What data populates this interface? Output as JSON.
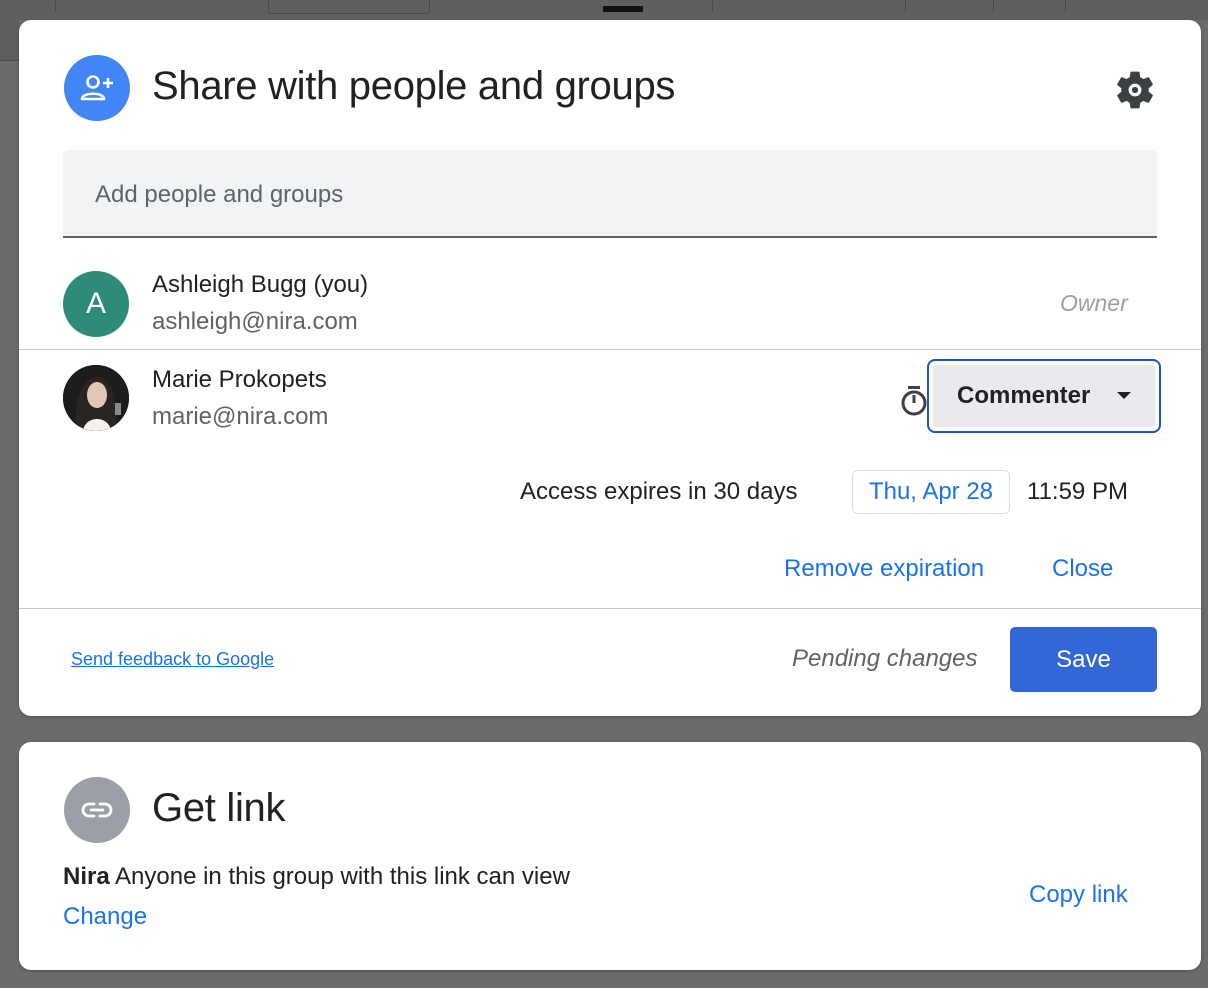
{
  "share": {
    "title": "Share with people and groups",
    "add_placeholder": "Add people and groups",
    "people": [
      {
        "initial": "A",
        "name": "Ashleigh Bugg (you)",
        "email": "ashleigh@nira.com",
        "role": "Owner"
      },
      {
        "name": "Marie Prokopets",
        "email": "marie@nira.com",
        "role": "Commenter"
      }
    ],
    "expiration": {
      "text": "Access expires in 30 days",
      "date": "Thu, Apr 28",
      "time": "11:59 PM",
      "remove_label": "Remove expiration",
      "close_label": "Close"
    },
    "footer": {
      "feedback_label": "Send feedback to Google",
      "pending_label": "Pending changes",
      "save_label": "Save"
    }
  },
  "get_link": {
    "title": "Get link",
    "group_name": "Nira",
    "description": "Anyone in this group with this link can view",
    "change_label": "Change",
    "copy_label": "Copy link"
  },
  "colors": {
    "accent": "#1a73e8",
    "save_button": "#3367d6",
    "header_icon": "#4285f4",
    "avatar": "#2e8b77",
    "link_icon": "#9aa0a6"
  }
}
